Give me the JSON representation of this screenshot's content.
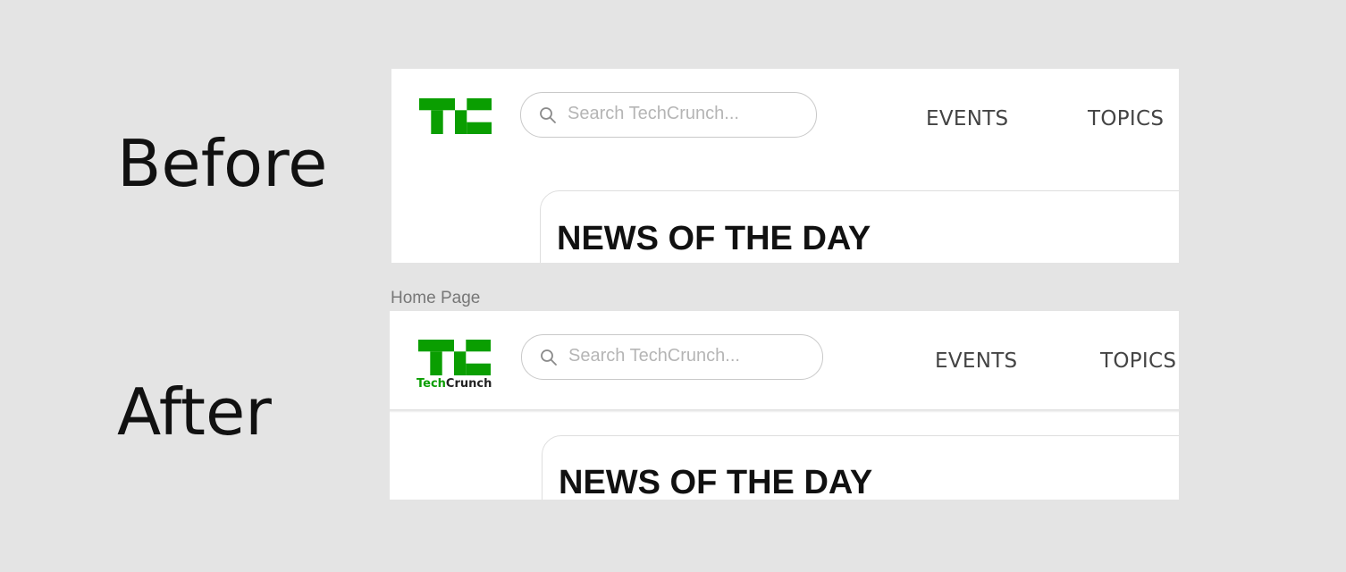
{
  "labels": {
    "before": "Before",
    "after": "After",
    "after_frame_caption": "Home Page"
  },
  "colors": {
    "background": "#e4e4e4",
    "brand_green": "#0a9e01",
    "nav_text": "#444444"
  },
  "before": {
    "logo_icon": "techcrunch-tc-logo",
    "search": {
      "placeholder": "Search TechCrunch...",
      "icon": "search-icon"
    },
    "nav": [
      "EVENTS",
      "TOPICS"
    ],
    "card_title": "NEWS OF THE DAY"
  },
  "after": {
    "logo_icon": "techcrunch-tc-logo",
    "logo_wordmark": {
      "part1": "Tech",
      "part2": "Crunch"
    },
    "search": {
      "placeholder": "Search TechCrunch...",
      "icon": "search-icon"
    },
    "nav": [
      "EVENTS",
      "TOPICS"
    ],
    "card_title": "NEWS OF THE DAY"
  }
}
